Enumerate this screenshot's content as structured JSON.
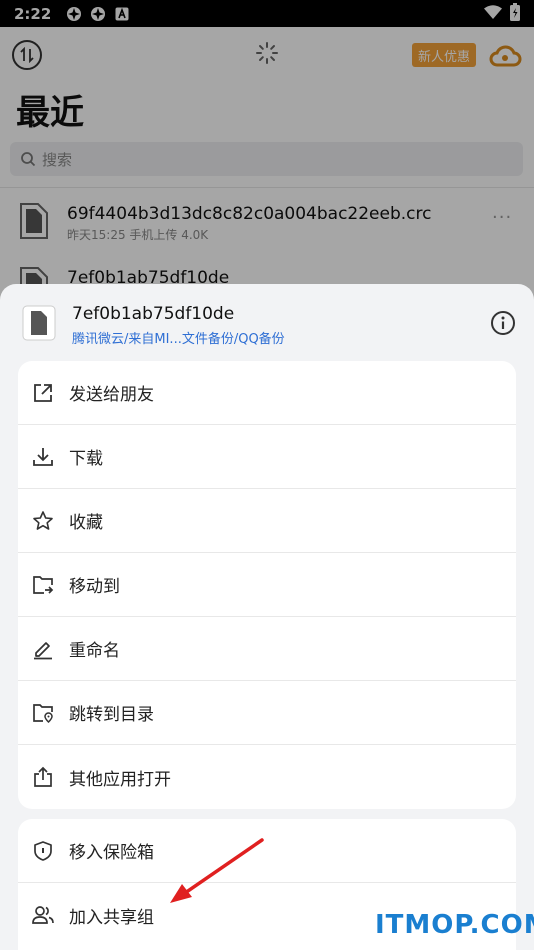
{
  "status_bar": {
    "time": "2:22"
  },
  "app": {
    "promo_label": "新人优惠",
    "page_title": "最近",
    "search_placeholder": "搜索",
    "files": [
      {
        "name": "69f4404b3d13dc8c82c0a004bac22eeb.crc",
        "meta": "昨天15:25  手机上传  4.0K",
        "more": "···"
      },
      {
        "name": "7ef0b1ab75df10de",
        "meta": "",
        "more": ""
      }
    ]
  },
  "sheet": {
    "file_name": "7ef0b1ab75df10de",
    "file_path": "腾讯微云/来自MI...文件备份/QQ备份",
    "group1": [
      {
        "label": "发送给朋友",
        "icon": "share-icon"
      },
      {
        "label": "下载",
        "icon": "download-icon"
      },
      {
        "label": "收藏",
        "icon": "star-icon"
      },
      {
        "label": "移动到",
        "icon": "move-folder-icon"
      },
      {
        "label": "重命名",
        "icon": "pencil-icon"
      },
      {
        "label": "跳转到目录",
        "icon": "folder-locate-icon"
      },
      {
        "label": "其他应用打开",
        "icon": "open-with-icon"
      }
    ],
    "group2": [
      {
        "label": "移入保险箱",
        "icon": "shield-icon"
      },
      {
        "label": "加入共享组",
        "icon": "group-users-icon"
      }
    ]
  },
  "watermark": "ITMOP.COM",
  "colors": {
    "accent_blue": "#2f6fd4",
    "promo_orange": "#f3a23a",
    "annotation_red": "#e02020"
  }
}
